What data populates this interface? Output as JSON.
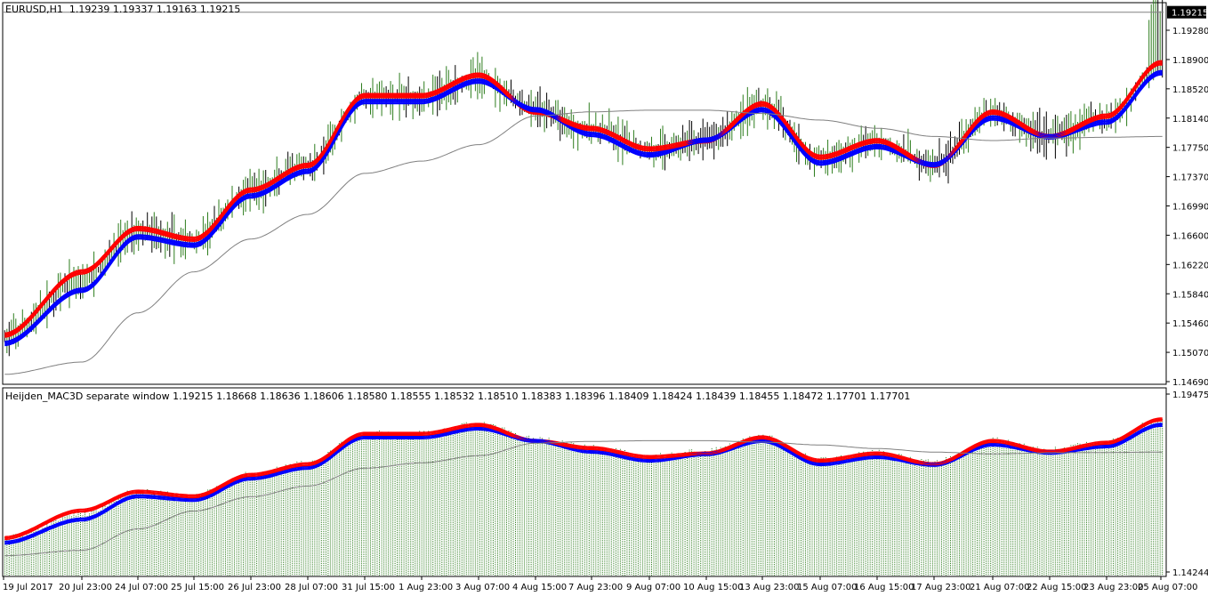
{
  "main": {
    "symbol_label": "EURUSD,H1",
    "ohlc": "1.19239 1.19337 1.19163 1.19215",
    "current_price": "1.19215",
    "y_ticks": [
      "1.19280",
      "1.18900",
      "1.18520",
      "1.18140",
      "1.17750",
      "1.17370",
      "1.16990",
      "1.16600",
      "1.16220",
      "1.15840",
      "1.15460",
      "1.15070",
      "1.14690"
    ]
  },
  "sub": {
    "info": "Heijden_MAC3D separate window 1.19215 1.18668 1.18636 1.18606 1.18580 1.18555 1.18532 1.18510 1.18383 1.18396 1.18409 1.18424 1.18439 1.18455 1.18472 1.17701 1.17701",
    "y_ticks": [
      "1.19475",
      "1.14244"
    ]
  },
  "x_labels": [
    "19 Jul 2017",
    "20 Jul 23:00",
    "24 Jul 07:00",
    "25 Jul 15:00",
    "26 Jul 23:00",
    "28 Jul 07:00",
    "31 Jul 15:00",
    "1 Aug 23:00",
    "3 Aug 07:00",
    "4 Aug 15:00",
    "7 Aug 23:00",
    "9 Aug 07:00",
    "10 Aug 15:00",
    "13 Aug 23:00",
    "15 Aug 07:00",
    "16 Aug 15:00",
    "17 Aug 23:00",
    "21 Aug 07:00",
    "22 Aug 15:00",
    "23 Aug 23:00",
    "25 Aug 07:00"
  ],
  "colors": {
    "bull_bar": "#2e7d1e",
    "bear_bar": "#000000",
    "fast_ma": "#ff0000",
    "slow_ma": "#0000ff",
    "long_ma": "#808080",
    "fill": "#d8a0b0",
    "price_line": "#808080"
  },
  "chart_data": [
    {
      "type": "line",
      "title": "EURUSD,H1",
      "ylim": [
        1.1469,
        1.1932
      ],
      "price_anchors": {
        "dates": [
          "19 Jul 2017",
          "20 Jul 23:00",
          "24 Jul 07:00",
          "25 Jul 15:00",
          "26 Jul 23:00",
          "28 Jul 07:00",
          "31 Jul 15:00",
          "1 Aug 23:00",
          "3 Aug 07:00",
          "4 Aug 15:00",
          "7 Aug 23:00",
          "9 Aug 07:00",
          "10 Aug 15:00",
          "13 Aug 23:00",
          "15 Aug 07:00",
          "16 Aug 15:00",
          "17 Aug 23:00",
          "21 Aug 07:00",
          "22 Aug 15:00",
          "23 Aug 23:00",
          "25 Aug 07:00"
        ],
        "fast_ma": [
          1.1528,
          1.1605,
          1.1658,
          1.1645,
          1.1705,
          1.1735,
          1.182,
          1.182,
          1.1845,
          1.18,
          1.178,
          1.1755,
          1.1765,
          1.181,
          1.1745,
          1.1765,
          1.1735,
          1.18,
          1.177,
          1.1795,
          1.186
        ],
        "slow_ma": [
          1.152,
          1.1585,
          1.165,
          1.164,
          1.17,
          1.173,
          1.1815,
          1.1815,
          1.184,
          1.1805,
          1.1775,
          1.175,
          1.1768,
          1.1805,
          1.174,
          1.176,
          1.1738,
          1.1795,
          1.1772,
          1.179,
          1.185
        ],
        "long_ma": [
          1.148,
          1.1495,
          1.1555,
          1.1605,
          1.1645,
          1.1675,
          1.1725,
          1.174,
          1.176,
          1.1795,
          1.18,
          1.1802,
          1.1802,
          1.1798,
          1.179,
          1.178,
          1.177,
          1.1765,
          1.1768,
          1.1769,
          1.177
        ]
      },
      "current_price": 1.19215
    },
    {
      "type": "area",
      "title": "Heijden_MAC3D separate window",
      "ylim": [
        1.14244,
        1.19475
      ]
    }
  ]
}
